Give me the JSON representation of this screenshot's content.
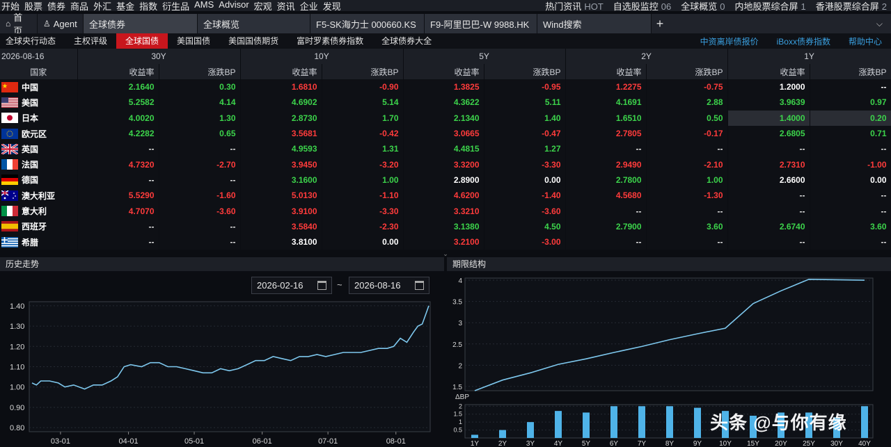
{
  "menubar": {
    "items": [
      "开始",
      "股票",
      "债券",
      "商品",
      "外汇",
      "基金",
      "指数",
      "衍生品",
      "AMS",
      "Advisor",
      "宏观",
      "资讯",
      "企业",
      "发现"
    ],
    "right": [
      {
        "label": "热门资讯",
        "badge": "HOT"
      },
      {
        "label": "自选股监控",
        "badge": "06"
      },
      {
        "label": "全球概览",
        "badge": "0"
      },
      {
        "label": "内地股票综合屏",
        "badge": "1"
      },
      {
        "label": "香港股票综合屏",
        "badge": "2"
      }
    ]
  },
  "tabs": {
    "home": "首页",
    "agent": "Agent",
    "items": [
      "全球债券",
      "全球概览",
      "F5-SK海力士 000660.KS",
      "F9-阿里巴巴-W 9988.HK",
      "Wind搜索"
    ],
    "plus": "+",
    "chevron": "⌵"
  },
  "subnav": {
    "items": [
      "全球央行动态",
      "主权评级",
      "全球国债",
      "美国国债",
      "美国国债期货",
      "富时罗素债券指数",
      "全球债券大全"
    ],
    "active_index": 2,
    "right_links": [
      "中资离岸债报价",
      "iBoxx债券指数",
      "帮助中心"
    ]
  },
  "table": {
    "date": "2026-08-16",
    "tenors": [
      "30Y",
      "10Y",
      "5Y",
      "2Y",
      "1Y"
    ],
    "country_header": "国家",
    "yield_header": "收益率",
    "change_header": "涨跌BP",
    "rows": [
      {
        "country": "中国",
        "flag": "cn",
        "cells": [
          [
            "2.1640",
            "0.30",
            "down"
          ],
          [
            "1.6810",
            "-0.90",
            "up"
          ],
          [
            "1.3825",
            "-0.95",
            "up"
          ],
          [
            "1.2275",
            "-0.75",
            "up"
          ],
          [
            "1.2000",
            "--",
            "flat"
          ]
        ]
      },
      {
        "country": "美国",
        "flag": "us",
        "cells": [
          [
            "5.2582",
            "4.14",
            "down"
          ],
          [
            "4.6902",
            "5.14",
            "down"
          ],
          [
            "4.3622",
            "5.11",
            "down"
          ],
          [
            "4.1691",
            "2.88",
            "down"
          ],
          [
            "3.9639",
            "0.97",
            "down"
          ]
        ]
      },
      {
        "country": "日本",
        "flag": "jp",
        "cells": [
          [
            "4.0020",
            "1.30",
            "down"
          ],
          [
            "2.8730",
            "1.70",
            "down"
          ],
          [
            "2.1340",
            "1.40",
            "down"
          ],
          [
            "1.6510",
            "0.50",
            "down"
          ],
          [
            "1.4000",
            "0.20",
            "down"
          ]
        ]
      },
      {
        "country": "欧元区",
        "flag": "eu",
        "cells": [
          [
            "4.2282",
            "0.65",
            "down"
          ],
          [
            "3.5681",
            "-0.42",
            "up"
          ],
          [
            "3.0665",
            "-0.47",
            "up"
          ],
          [
            "2.7805",
            "-0.17",
            "up"
          ],
          [
            "2.6805",
            "0.71",
            "down"
          ]
        ]
      },
      {
        "country": "英国",
        "flag": "gb",
        "cells": [
          [
            "--",
            "--",
            "dash"
          ],
          [
            "4.9593",
            "1.31",
            "down"
          ],
          [
            "4.4815",
            "1.27",
            "down"
          ],
          [
            "--",
            "--",
            "dash"
          ],
          [
            "--",
            "--",
            "dash"
          ]
        ]
      },
      {
        "country": "法国",
        "flag": "fr",
        "cells": [
          [
            "4.7320",
            "-2.70",
            "up"
          ],
          [
            "3.9450",
            "-3.20",
            "up"
          ],
          [
            "3.3200",
            "-3.30",
            "up"
          ],
          [
            "2.9490",
            "-2.10",
            "up"
          ],
          [
            "2.7310",
            "-1.00",
            "up"
          ]
        ]
      },
      {
        "country": "德国",
        "flag": "de",
        "cells": [
          [
            "--",
            "--",
            "dash"
          ],
          [
            "3.1600",
            "1.00",
            "down"
          ],
          [
            "2.8900",
            "0.00",
            "flat"
          ],
          [
            "2.7800",
            "1.00",
            "down"
          ],
          [
            "2.6600",
            "0.00",
            "flat"
          ]
        ]
      },
      {
        "country": "澳大利亚",
        "flag": "au",
        "cells": [
          [
            "5.5290",
            "-1.60",
            "up"
          ],
          [
            "5.0130",
            "-1.10",
            "up"
          ],
          [
            "4.6200",
            "-1.40",
            "up"
          ],
          [
            "4.5680",
            "-1.30",
            "up"
          ],
          [
            "--",
            "--",
            "dash"
          ]
        ]
      },
      {
        "country": "意大利",
        "flag": "it",
        "cells": [
          [
            "4.7070",
            "-3.60",
            "up"
          ],
          [
            "3.9100",
            "-3.30",
            "up"
          ],
          [
            "3.3210",
            "-3.60",
            "up"
          ],
          [
            "--",
            "--",
            "dash"
          ],
          [
            "--",
            "--",
            "dash"
          ]
        ]
      },
      {
        "country": "西班牙",
        "flag": "es",
        "cells": [
          [
            "--",
            "--",
            "dash"
          ],
          [
            "3.5840",
            "-2.30",
            "up"
          ],
          [
            "3.1380",
            "4.50",
            "down"
          ],
          [
            "2.7900",
            "3.60",
            "down"
          ],
          [
            "2.6740",
            "3.60",
            "down"
          ]
        ]
      },
      {
        "country": "希腊",
        "flag": "gr",
        "cells": [
          [
            "--",
            "--",
            "dash"
          ],
          [
            "3.8100",
            "0.00",
            "flat"
          ],
          [
            "3.2100",
            "-3.00",
            "up"
          ],
          [
            "--",
            "--",
            "dash"
          ],
          [
            "--",
            "--",
            "dash"
          ]
        ]
      }
    ]
  },
  "history": {
    "title": "历史走势",
    "start_date": "2026-02-16",
    "end_date": "2026-08-16",
    "separator": "~"
  },
  "term": {
    "title": "期限结构"
  },
  "watermark": "头条 @与你有缘",
  "colors": {
    "up": "#ff3b3b",
    "down": "#3cd34b",
    "accent": "#c8161d",
    "line": "#7ec8ee",
    "bar": "#4fb3e8",
    "link": "#3aa0e0"
  },
  "chart_data": [
    {
      "type": "line",
      "xlabel": "",
      "ylabel": "",
      "ylim": [
        0.78,
        1.42
      ],
      "yticks": [
        "1.40",
        "1.30",
        "1.20",
        "1.10",
        "1.00",
        "0.90",
        "0.80"
      ],
      "xticks": [
        "03-01",
        "04-01",
        "05-01",
        "06-01",
        "07-01",
        "08-01"
      ],
      "x": [
        "2026-02-16",
        "2026-02-18",
        "2026-02-20",
        "2026-02-24",
        "2026-02-28",
        "2026-03-03",
        "2026-03-07",
        "2026-03-12",
        "2026-03-16",
        "2026-03-20",
        "2026-03-24",
        "2026-03-27",
        "2026-03-30",
        "2026-04-02",
        "2026-04-07",
        "2026-04-11",
        "2026-04-15",
        "2026-04-19",
        "2026-04-23",
        "2026-04-27",
        "2026-05-01",
        "2026-05-05",
        "2026-05-09",
        "2026-05-13",
        "2026-05-17",
        "2026-05-21",
        "2026-05-25",
        "2026-05-29",
        "2026-06-02",
        "2026-06-06",
        "2026-06-10",
        "2026-06-14",
        "2026-06-18",
        "2026-06-22",
        "2026-06-26",
        "2026-06-30",
        "2026-07-04",
        "2026-07-08",
        "2026-07-12",
        "2026-07-16",
        "2026-07-20",
        "2026-07-24",
        "2026-07-28",
        "2026-07-31",
        "2026-08-03",
        "2026-08-06",
        "2026-08-09",
        "2026-08-11",
        "2026-08-13",
        "2026-08-15",
        "2026-08-16"
      ],
      "values": [
        1.02,
        1.01,
        1.03,
        1.03,
        1.02,
        1.0,
        1.01,
        0.99,
        1.01,
        1.01,
        1.03,
        1.05,
        1.1,
        1.11,
        1.1,
        1.12,
        1.12,
        1.1,
        1.1,
        1.09,
        1.08,
        1.07,
        1.07,
        1.09,
        1.08,
        1.09,
        1.11,
        1.13,
        1.13,
        1.15,
        1.14,
        1.13,
        1.15,
        1.15,
        1.16,
        1.15,
        1.16,
        1.17,
        1.17,
        1.17,
        1.18,
        1.19,
        1.19,
        1.2,
        1.24,
        1.22,
        1.27,
        1.3,
        1.31,
        1.37,
        1.4
      ]
    },
    {
      "type": "line",
      "xlabel": "",
      "ylabel": "",
      "ylim": [
        1.4,
        4.05
      ],
      "yticks": [
        "4",
        "3.5",
        "3",
        "2.5",
        "2",
        "1.5"
      ],
      "categories": [
        "1Y",
        "2Y",
        "3Y",
        "4Y",
        "5Y",
        "6Y",
        "7Y",
        "8Y",
        "9Y",
        "10Y",
        "15Y",
        "20Y",
        "25Y",
        "30Y",
        "40Y"
      ],
      "values": [
        1.4,
        1.65,
        1.82,
        2.02,
        2.15,
        2.3,
        2.44,
        2.6,
        2.74,
        2.87,
        3.45,
        3.75,
        4.02,
        4.01,
        4.0
      ]
    },
    {
      "type": "bar",
      "ylabel": "ΔBP",
      "ylim": [
        0,
        2.1
      ],
      "yticks": [
        "2",
        "1.5",
        "1",
        "0.5"
      ],
      "categories": [
        "1Y",
        "2Y",
        "3Y",
        "4Y",
        "5Y",
        "6Y",
        "7Y",
        "8Y",
        "9Y",
        "10Y",
        "15Y",
        "20Y",
        "25Y",
        "30Y",
        "40Y"
      ],
      "values": [
        0.2,
        0.5,
        1.0,
        1.7,
        1.6,
        2.0,
        2.0,
        2.0,
        1.9,
        1.7,
        1.4,
        1.6,
        1.6,
        1.3,
        2.0
      ]
    }
  ]
}
